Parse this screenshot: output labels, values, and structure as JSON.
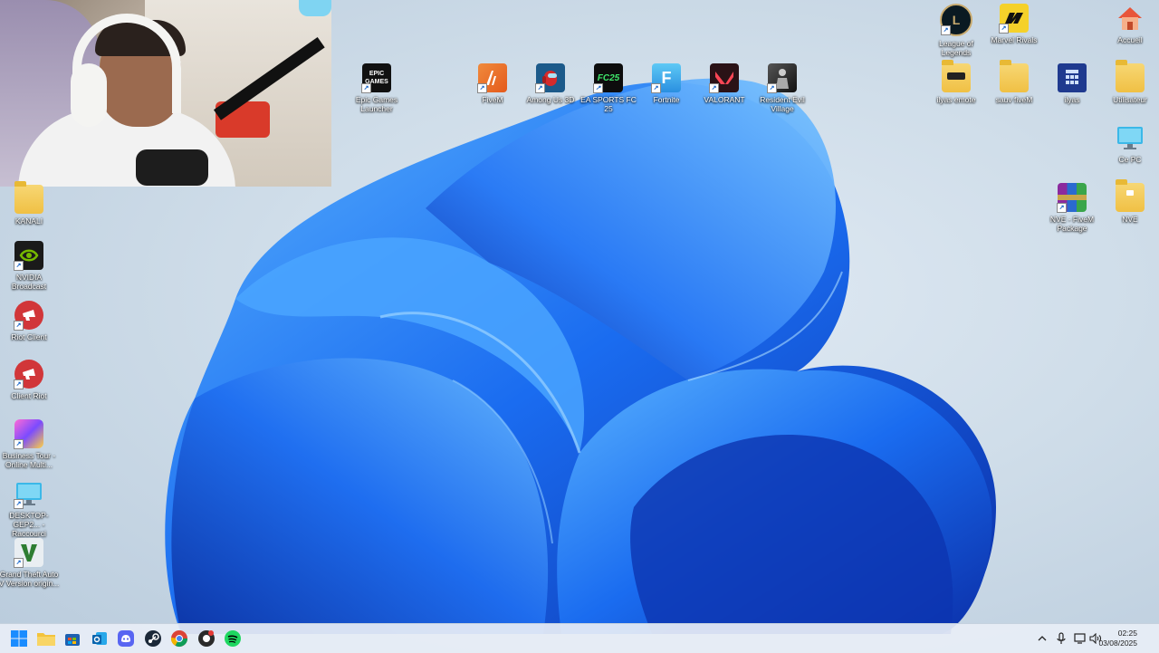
{
  "webcam": {
    "label": ""
  },
  "desktop_icons": {
    "epic": "Epic Games Launcher",
    "epic_logo": "EPIC GAMES",
    "fivem": "FiveM",
    "among": "Among Us 3D",
    "fc25": "EA SPORTS FC 25",
    "fc25_logo": "FC25",
    "fortnite": "Fortnite",
    "fortnite_logo": "F",
    "valorant": "VALORANT",
    "resident": "Resident Evil Village",
    "lol": "League of Legends",
    "marvel": "Marvel Rivals",
    "accueil": "Accueil",
    "ilyas_emote": "ilyas emote",
    "sauv_fivem": "sauv fiveM",
    "ilyas": "ilyas",
    "utilisateur": "Utilisateur",
    "cepc": "Ce PC",
    "nve_pkg": "NVE - FiveM Package",
    "nve": "NVE",
    "kanali": "KANALI",
    "nvidia": "NVIDIA Broadcast",
    "riot_client": "Riot Client",
    "client_riot": "Client Riot",
    "business": "Business Tour - Online Multi...",
    "desktop": "DESKTOP-GEP2... - Raccourci",
    "gta": "Grand Theft Auto V Version origin..."
  },
  "taskbar": {
    "time": "02:25",
    "date": "03/08/2025"
  },
  "colors": {
    "accent": "#1463c7",
    "taskbar_bg": "#e8eef6"
  }
}
